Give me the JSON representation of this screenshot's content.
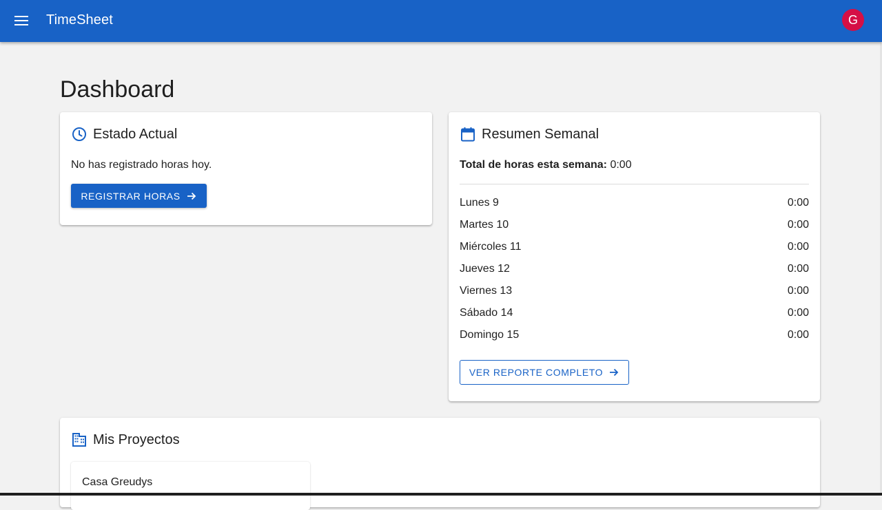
{
  "app": {
    "title": "TimeSheet",
    "avatar_initial": "G",
    "menu_icon": "menu-icon"
  },
  "page": {
    "title": "Dashboard"
  },
  "estado_actual": {
    "title": "Estado Actual",
    "icon": "clock-icon",
    "message": "No has registrado horas hoy.",
    "button_label": "REGISTRAR HORAS",
    "button_icon": "arrow-right-icon"
  },
  "resumen_semanal": {
    "title": "Resumen Semanal",
    "icon": "calendar-icon",
    "total_label": "Total de horas esta semana:",
    "total_value": "0:00",
    "days": [
      {
        "day": "Lunes 9",
        "hours": "0:00"
      },
      {
        "day": "Martes 10",
        "hours": "0:00"
      },
      {
        "day": "Miércoles 11",
        "hours": "0:00"
      },
      {
        "day": "Jueves 12",
        "hours": "0:00"
      },
      {
        "day": "Viernes 13",
        "hours": "0:00"
      },
      {
        "day": "Sábado 14",
        "hours": "0:00"
      },
      {
        "day": "Domingo 15",
        "hours": "0:00"
      }
    ],
    "button_label": "VER REPORTE COMPLETO",
    "button_icon": "arrow-right-icon"
  },
  "proyectos": {
    "title": "Mis Proyectos",
    "icon": "building-icon",
    "items": [
      {
        "name": "Casa Greudys"
      }
    ]
  },
  "colors": {
    "primary": "#1862c6",
    "avatar": "#d50f45",
    "background": "#f2f2f2"
  }
}
